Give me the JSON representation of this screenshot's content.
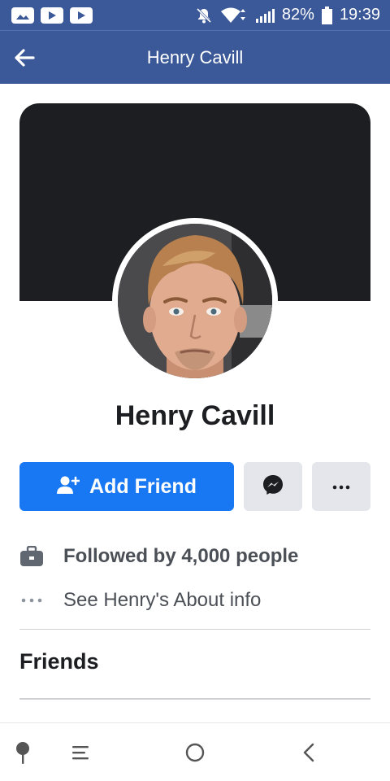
{
  "status_bar": {
    "battery_percent": "82%",
    "time": "19:39",
    "icons": [
      "gallery-icon",
      "youtube-icon",
      "youtube-icon",
      "notifications-off-icon",
      "wifi-icon",
      "signal-icon",
      "battery-icon"
    ]
  },
  "app_bar": {
    "title": "Henry Cavill"
  },
  "profile": {
    "name": "Henry Cavill"
  },
  "actions": {
    "add_friend_label": "Add Friend"
  },
  "info": {
    "followed": "Followed by 4,000 people",
    "about": "See Henry's About info"
  },
  "sections": {
    "friends_title": "Friends"
  },
  "colors": {
    "brand": "#3b5998",
    "primary_button": "#1877f2",
    "secondary_button": "#e4e6eb",
    "cover": "#1c1e21"
  }
}
